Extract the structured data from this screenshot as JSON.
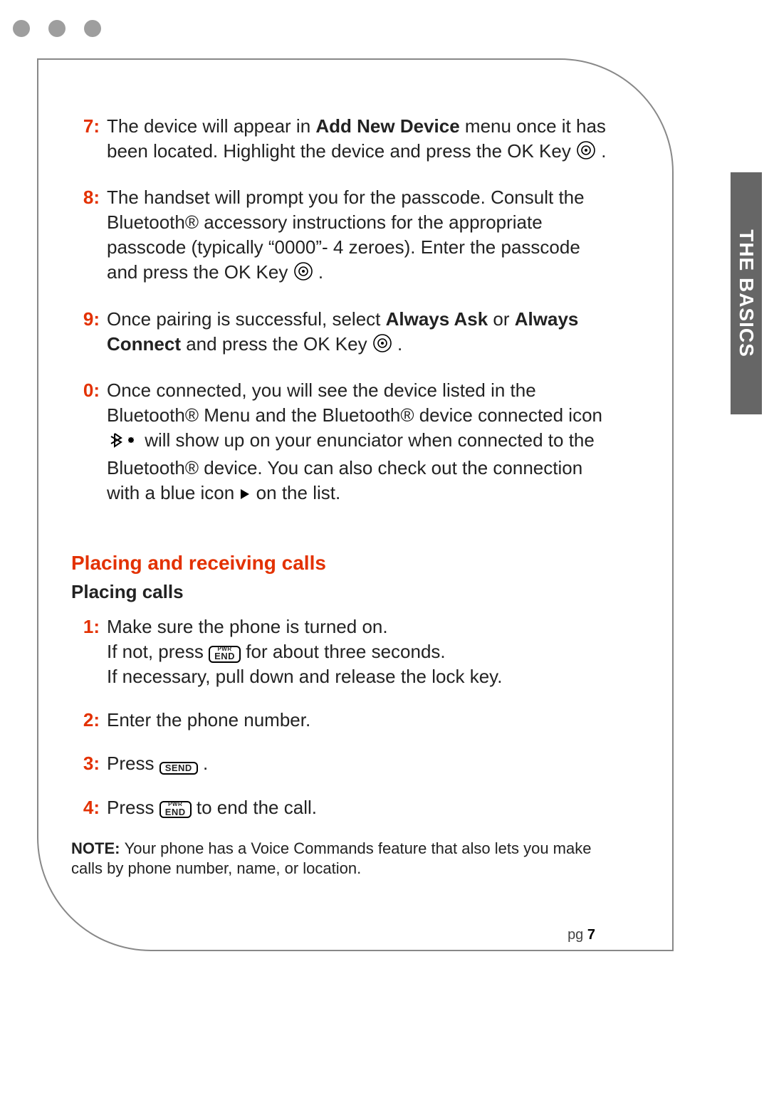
{
  "side_tab": "THE BASICS",
  "page_prefix": "pg ",
  "page_number": "7",
  "steps_top": [
    {
      "n": "7:",
      "pre": "The device will appear in ",
      "b1": "Add New Device",
      "mid": " menu once it has been located. Highlight the device and press the OK Key ",
      "tail": " .",
      "icon": "ok"
    },
    {
      "n": "8:",
      "pre": "The handset will prompt you for the passcode. Consult the Bluetooth® accessory instructions for the appropriate passcode (typically “0000”- 4 zeroes). Enter the passcode and press the OK Key ",
      "tail": " .",
      "icon": "ok"
    },
    {
      "n": "9:",
      "pre": "Once pairing is successful, select ",
      "b1": "Always Ask",
      "mid": " or ",
      "b2": "Always Connect",
      "mid2": " and press the OK Key ",
      "tail": " .",
      "icon": "ok"
    },
    {
      "n": "0:",
      "pre": "Once connected, you will see the device listed in the Bluetooth® Menu and the Bluetooth® device connected icon ",
      "icon": "bt",
      "mid": " will show up on your enunciator when connected to the Bluetooth® device. You can also check out the connection with a blue icon ",
      "icon2": "tri",
      "tail": " on the list."
    }
  ],
  "section_title": "Placing and receiving calls",
  "sub_title": "Placing calls",
  "steps_bottom": [
    {
      "n": "1:",
      "line1": "Make sure the phone is turned on.",
      "line2_pre": "If not, press ",
      "key": "end",
      "line2_post": " for about three seconds.",
      "line3": "If necessary, pull down and release the lock key."
    },
    {
      "n": "2:",
      "line1": "Enter the phone number."
    },
    {
      "n": "3:",
      "line1_pre": "Press ",
      "key": "send",
      "line1_post": " ."
    },
    {
      "n": "4:",
      "line1_pre": "Press ",
      "key": "end",
      "line1_post": " to end the call."
    }
  ],
  "note_label": "NOTE: ",
  "note_text": "Your phone has a Voice Commands feature that also lets you make calls by phone number, name, or location.",
  "keys": {
    "send": "SEND",
    "end_top": "PWR",
    "end": "END"
  }
}
